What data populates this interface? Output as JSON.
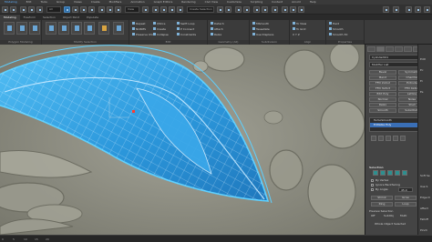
{
  "menubar": {
    "items": [
      "Modeling",
      "Edit",
      "Tools",
      "Group",
      "Views",
      "Create",
      "Modifiers",
      "Animation",
      "Graph Editors",
      "Rendering",
      "Civil View",
      "Customize",
      "Scripting",
      "Content",
      "Arnold",
      "Help"
    ],
    "active_index": 0
  },
  "toolbar": {
    "selection_filter": "All",
    "view_label": "View",
    "create_selection_set": "Create Selection Se"
  },
  "ribbon_tabs": {
    "items": [
      "Modeling",
      "Freeform",
      "Selection",
      "Object Paint",
      "Populate"
    ],
    "active_index": 0
  },
  "ribbon": {
    "groups": {
      "polygon_modeling": "Polygon Modeling",
      "modify_selection": "Modify Selection",
      "edit": "Edit",
      "geometry_all": "Geometry (All)",
      "subdivision": "Subdivision",
      "align": "Align",
      "properties": "Properties"
    },
    "edit_rows": [
      "Repeat",
      "NURMS",
      "Preserve UVs"
    ],
    "edit_rows2": [
      "QSlice",
      "Create",
      "Collapse"
    ],
    "edit_rows3": [
      "Swift Loop",
      "P Connect",
      "Constraints"
    ],
    "geometry_rows": [
      "Detach",
      "Attach",
      "Relax"
    ],
    "subdivision_rows": [
      "MSmooth",
      "Tessellate",
      "Use Displace"
    ],
    "align_rows": [
      "To View",
      "To Grid",
      "X  Y  Z"
    ],
    "properties_rows": [
      "Hard",
      "Smooth",
      "Smooth 30"
    ]
  },
  "command_panel": {
    "object_name": "Cylinder001",
    "modifier_list": "Modifier List",
    "buttons": [
      "Bevel",
      "Symmetry",
      "Bend",
      "Chamfer",
      "FFD 2x2x2",
      "Extrude",
      "FFD 3x3x3",
      "FFD 4x4x4",
      "Edit Poly",
      "Lattice",
      "Normal",
      "Noise",
      "Relax",
      "Shell",
      "Smooth",
      "Substitute"
    ],
    "stack": [
      "TurboSmooth",
      "Editable Poly"
    ],
    "stack_selected": 1,
    "section_selection": "Selection",
    "by_vertex": "By Vertex",
    "ignore_backfacing": "Ignore Backfacing",
    "by_angle": "By Angle:",
    "by_angle_value": "45.0",
    "shrink": "Shrink",
    "grow": "Grow",
    "ring": "Ring",
    "loop": "Loop",
    "preview_selection": "Preview Selection",
    "preview_off": "Off",
    "preview_subobj": "SubObj",
    "preview_multi": "Multi",
    "whole_object_selected": "Whole Object Selected",
    "accent": "#2f8ed8"
  },
  "command_panel2": {
    "labels": [
      "Edit",
      "Ec",
      "Ei",
      "Es",
      "Soft Se",
      "Use S",
      "Edge D",
      "Affect",
      "Falloff",
      "Pinch",
      "Bubble"
    ]
  },
  "statusbar": {
    "ticks": [
      "0",
      "5",
      "10",
      "15",
      "20"
    ]
  },
  "colors": {
    "mesh_fill": "#2fa3e8",
    "mesh_wire": "#d8efff",
    "mesh_outline": "#5ed0ff",
    "relief": "#8f8f83",
    "selection_vertex": "#ff3b2f"
  }
}
